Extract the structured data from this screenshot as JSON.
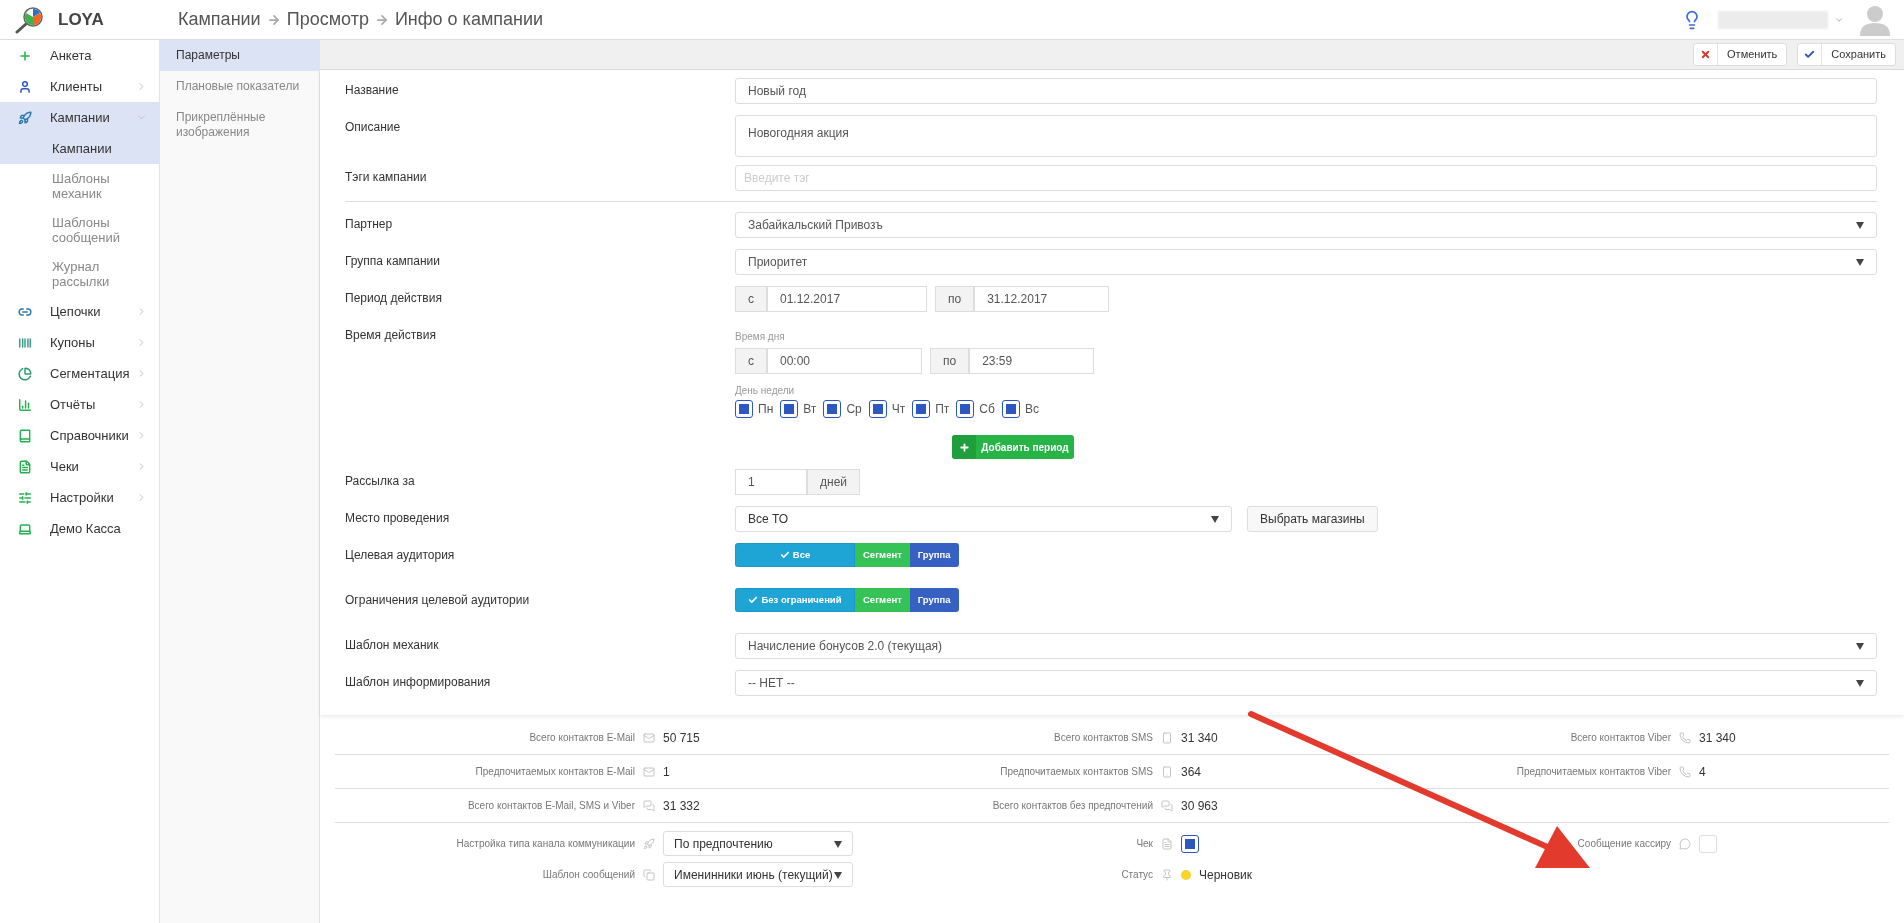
{
  "logo": {
    "text": "LOYA"
  },
  "breadcrumb": [
    "Кампании",
    "Просмотр",
    "Инфо о кампании"
  ],
  "sidebar": {
    "items": [
      {
        "label": "Анкета",
        "selected": false
      },
      {
        "label": "Клиенты",
        "selected": false,
        "expanded": false
      },
      {
        "label": "Кампании",
        "selected": true,
        "expanded": true,
        "children": [
          {
            "label": "Кампании",
            "selected": true
          },
          {
            "label": "Шаблоны механик",
            "selected": false
          },
          {
            "label": "Шаблоны сообщений",
            "selected": false
          },
          {
            "label": "Журнал рассылки",
            "selected": false
          }
        ]
      },
      {
        "label": "Цепочки",
        "selected": false,
        "expanded": false
      },
      {
        "label": "Купоны",
        "selected": false,
        "expanded": false
      },
      {
        "label": "Сегментация",
        "selected": false,
        "expanded": false
      },
      {
        "label": "Отчёты",
        "selected": false,
        "expanded": false
      },
      {
        "label": "Справочники",
        "selected": false,
        "expanded": false
      },
      {
        "label": "Чеки",
        "selected": false,
        "expanded": false
      },
      {
        "label": "Настройки",
        "selected": false,
        "expanded": false
      },
      {
        "label": "Демо Касса",
        "selected": false
      }
    ]
  },
  "subnav": [
    {
      "label": "Параметры",
      "selected": true
    },
    {
      "label": "Плановые показатели",
      "selected": false
    },
    {
      "label": "Прикреплённые изображения",
      "selected": false
    }
  ],
  "toolbar": [
    {
      "label": "Отменить",
      "kind": "cancel"
    },
    {
      "label": "Сохранить",
      "kind": "save"
    }
  ],
  "form": {
    "groups": [
      [
        {
          "kind": "text",
          "label": "Название",
          "value": "Новый год"
        },
        {
          "kind": "textarea",
          "label": "Описание",
          "value": "Новогодняя акция"
        },
        {
          "kind": "tags",
          "label": "Тэги кампании",
          "placeholder": "Введите тэг"
        }
      ],
      [
        {
          "kind": "select",
          "label": "Партнер",
          "value": "Забайкальский Привозъ"
        },
        {
          "kind": "select",
          "label": "Группа кампании",
          "value": "Приоритет"
        },
        {
          "kind": "range",
          "label": "Период действия",
          "from_prefix": "с",
          "from": "01.12.2017",
          "to_prefix": "по",
          "to": "31.12.2017"
        },
        {
          "kind": "time",
          "label": "Время действия",
          "time_label": "Время дня",
          "from_prefix": "с",
          "from": "00:00",
          "to_prefix": "по",
          "to": "23:59",
          "days_label": "День недели",
          "days": [
            {
              "label": "Пн",
              "checked": true
            },
            {
              "label": "Вт",
              "checked": true
            },
            {
              "label": "Ср",
              "checked": true
            },
            {
              "label": "Чт",
              "checked": true
            },
            {
              "label": "Пт",
              "checked": true
            },
            {
              "label": "Сб",
              "checked": true
            },
            {
              "label": "Вс",
              "checked": true
            }
          ],
          "add_button": "Добавить период"
        },
        {
          "kind": "addon",
          "label": "Рассылка за",
          "value": "1",
          "addon": "дней"
        },
        {
          "kind": "select_button",
          "label": "Место проведения",
          "value": "Все ТО",
          "button": "Выбрать магазины"
        },
        {
          "kind": "segmented",
          "label": "Целевая аудитория",
          "options": [
            {
              "label": "Все",
              "selected": true,
              "color": "#1ea5d6"
            },
            {
              "label": "Сегмент",
              "selected": false,
              "color": "#2bbf4e"
            },
            {
              "label": "Группа",
              "selected": false,
              "color": "#2d58c0"
            }
          ]
        },
        {
          "kind": "segmented",
          "label": "Ограничения целевой аудитории",
          "options": [
            {
              "label": "Без ограничений",
              "selected": true,
              "color": "#1ea5d6"
            },
            {
              "label": "Сегмент",
              "selected": false,
              "color": "#2bbf4e"
            },
            {
              "label": "Группа",
              "selected": false,
              "color": "#2d58c0"
            }
          ]
        },
        {
          "kind": "select",
          "label": "Шаблон механик",
          "value": "Начисление бонусов 2.0 (текущая)"
        },
        {
          "kind": "select",
          "label": "Шаблон информирования",
          "value": "-- НЕТ --"
        }
      ]
    ]
  },
  "stats": [
    [
      {
        "kind": "email",
        "label": "Всего контактов E-Mail",
        "value": "50 715"
      },
      {
        "kind": "sms",
        "label": "Всего контактов SMS",
        "value": "31 340"
      },
      {
        "kind": "viber",
        "label": "Всего контактов Viber",
        "value": "31 340"
      }
    ],
    [
      {
        "kind": "email",
        "label": "Предпочитаемых контактов E-Mail",
        "value": "1"
      },
      {
        "kind": "sms",
        "label": "Предпочитаемых контактов SMS",
        "value": "364"
      },
      {
        "kind": "viber",
        "label": "Предпочитаемых контактов Viber",
        "value": "4"
      }
    ],
    [
      {
        "kind": "chat",
        "label": "Всего контактов E-Mail, SMS и Viber",
        "value": "31 332"
      },
      {
        "kind": "chat",
        "label": "Всего контактов без предпочтений",
        "value": "30 963"
      }
    ]
  ],
  "settings": [
    [
      {
        "kind": "select",
        "label": "Настройка типа канала коммуникации",
        "value": "По предпочтению"
      },
      {
        "kind": "select",
        "label": "Шаблон сообщений",
        "value": "Именинники июнь (текущий)"
      }
    ],
    [
      {
        "kind": "checkbox",
        "label": "Чек",
        "checked": true
      },
      {
        "kind": "status",
        "label": "Статус",
        "value": "Черновик",
        "color": "#f8d42c"
      }
    ],
    [
      {
        "kind": "checkbox",
        "label": "Сообщение кассиру",
        "checked": false
      }
    ]
  ]
}
